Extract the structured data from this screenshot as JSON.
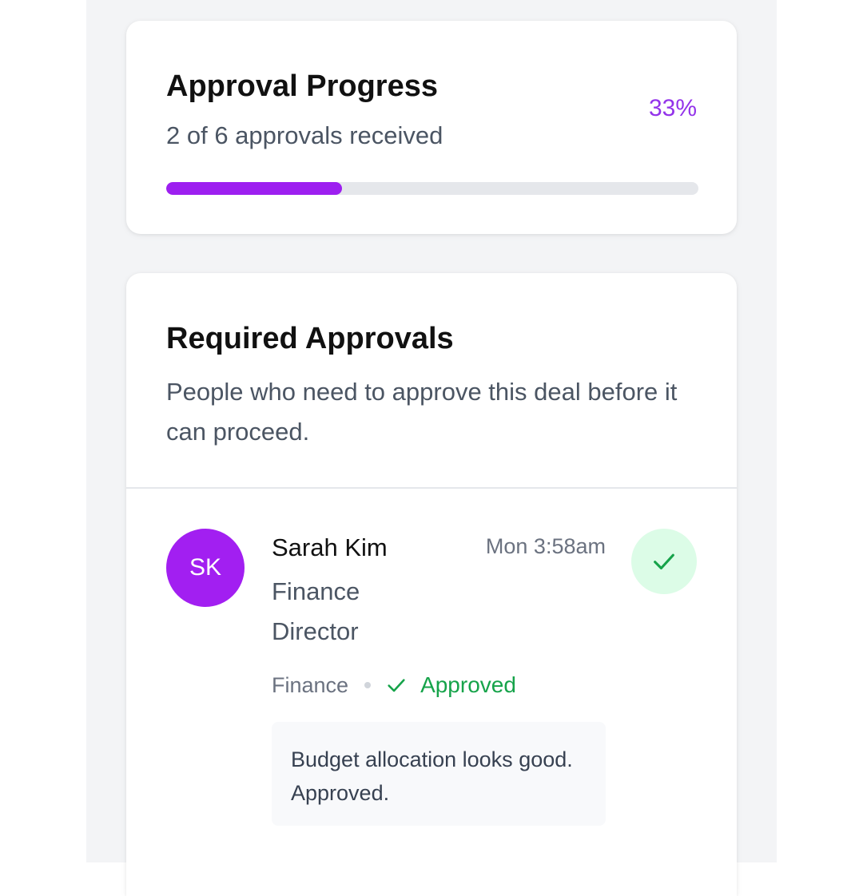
{
  "progress": {
    "title": "Approval Progress",
    "subtitle": "2 of 6 approvals received",
    "percent_label": "33%",
    "fraction": 0.33,
    "accent_color": "#9333ea"
  },
  "approvals": {
    "title": "Required Approvals",
    "description": "People who need to approve this deal before it can proceed.",
    "items": [
      {
        "initials": "SK",
        "name": "Sarah Kim",
        "role": "Finance Director",
        "time": "Mon 3:58am",
        "department": "Finance",
        "status": "Approved",
        "status_icon": "check-icon",
        "comment": "Budget allocation looks good. Approved.",
        "avatar_color": "#a21ff1",
        "status_color": "#16a34a"
      }
    ]
  }
}
